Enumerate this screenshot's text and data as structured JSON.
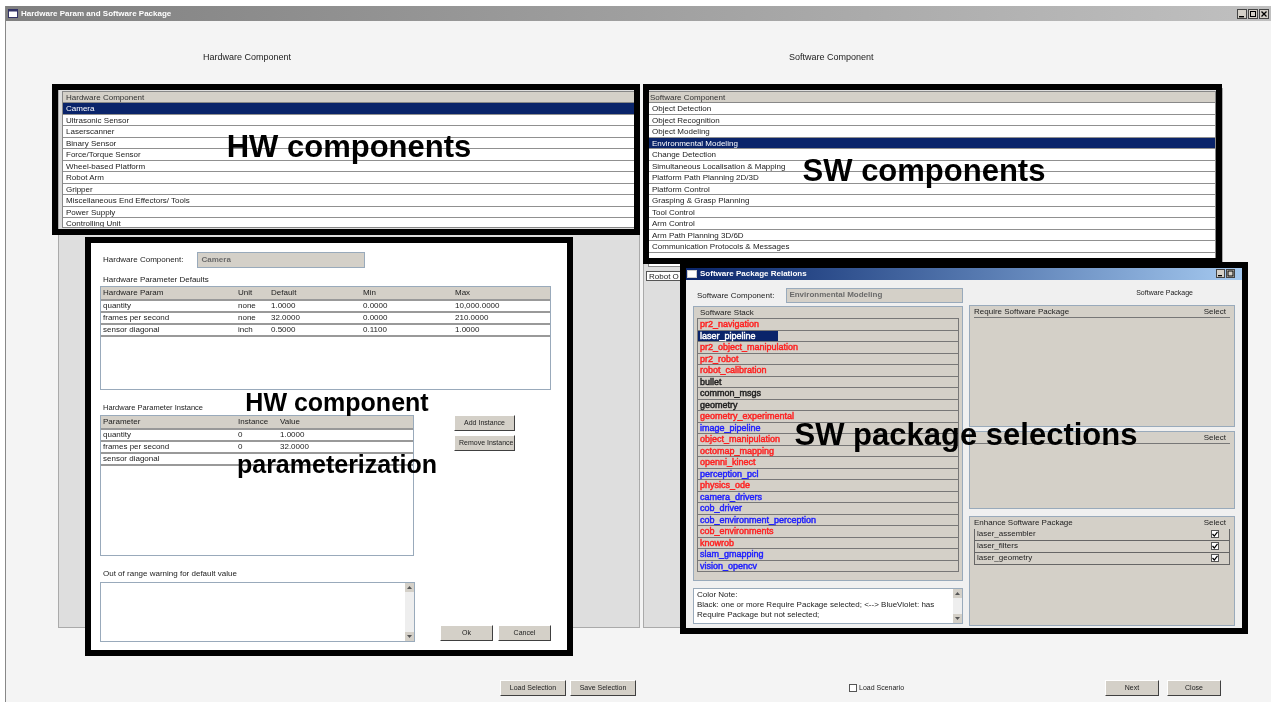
{
  "window": {
    "title": "Hardware Param and Software Package"
  },
  "hardware": {
    "heading": "Hardware Component",
    "list_header": "Hardware Component",
    "items": [
      {
        "label": "Camera",
        "selected": true
      },
      {
        "label": "Ultrasonic Sensor",
        "selected": false
      },
      {
        "label": "Laserscanner",
        "selected": false
      },
      {
        "label": "Binary Sensor",
        "selected": false
      },
      {
        "label": "Force/Torque Sensor",
        "selected": false
      },
      {
        "label": "Wheel-based Platform",
        "selected": false
      },
      {
        "label": "Robot Arm",
        "selected": false
      },
      {
        "label": "Gripper",
        "selected": false
      },
      {
        "label": "Miscellaneous End Effectors/ Tools",
        "selected": false
      },
      {
        "label": "Power Supply",
        "selected": false
      },
      {
        "label": "Controlling Unit",
        "selected": false
      }
    ]
  },
  "software": {
    "heading": "Software Component",
    "list_header": "Software Component",
    "items": [
      {
        "label": "Object Detection",
        "selected": false
      },
      {
        "label": "Object Recognition",
        "selected": false
      },
      {
        "label": "Object Modeling",
        "selected": false
      },
      {
        "label": "Environmental Modeling",
        "selected": true
      },
      {
        "label": "Change Detection",
        "selected": false
      },
      {
        "label": "Simultaneous Localisation & Mapping",
        "selected": false
      },
      {
        "label": "Platform Path Planning 2D/3D",
        "selected": false
      },
      {
        "label": "Platform Control",
        "selected": false
      },
      {
        "label": "Grasping & Grasp Planning",
        "selected": false
      },
      {
        "label": "Tool Control",
        "selected": false
      },
      {
        "label": "Arm Control",
        "selected": false
      },
      {
        "label": "Arm Path Planning 3D/6D",
        "selected": false
      },
      {
        "label": "Communication Protocols & Messages",
        "selected": false
      }
    ],
    "dropdown_value": "Robot O"
  },
  "hw_dialog": {
    "component_label": "Hardware Component:",
    "component_value": "Camera",
    "defaults_title": "Hardware Parameter Defaults",
    "defaults_columns": [
      "Hardware Param",
      "Unit",
      "Default",
      "Min",
      "Max"
    ],
    "defaults_rows": [
      [
        "quantity",
        "none",
        "1.0000",
        "0.0000",
        "10,000.0000"
      ],
      [
        "frames per second",
        "none",
        "32.0000",
        "0.0000",
        "210.0000"
      ],
      [
        "sensor diagonal",
        "inch",
        "0.5000",
        "0.1100",
        "1.0000"
      ]
    ],
    "instances_title": "Hardware Parameter Instance",
    "instance_columns": [
      "Parameter",
      "Instance",
      "Value"
    ],
    "instance_rows": [
      [
        "quantity",
        "0",
        "1.0000"
      ],
      [
        "frames per second",
        "0",
        "32.0000"
      ],
      [
        "sensor diagonal"
      ]
    ],
    "instance_buttons": [
      "Add Instance",
      "Remove Instance"
    ],
    "warning_label": "Out of range warning for default value",
    "footer_buttons": [
      "Ok",
      "Cancel"
    ]
  },
  "sw_dialog": {
    "title": "Software Package Relations",
    "component_label": "Software Component:",
    "component_value": "Environmental Modeling",
    "stack_header": "Software Stack",
    "packages": [
      {
        "name": "pr2_navigation",
        "selected": false,
        "color": "#ff2020"
      },
      {
        "name": "laser_pipeline",
        "selected": true
      },
      {
        "name": "pr2_object_manipulation",
        "selected": false,
        "color": "#ff2020"
      },
      {
        "name": "pr2_robot",
        "selected": false,
        "color": "#ff2020"
      },
      {
        "name": "robot_calibration",
        "selected": false,
        "color": "#ff2020"
      },
      {
        "name": "bullet",
        "selected": false,
        "color": "#202020"
      },
      {
        "name": "common_msgs",
        "selected": false,
        "color": "#202020"
      },
      {
        "name": "geometry",
        "selected": false,
        "color": "#202020"
      },
      {
        "name": "geometry_experimental",
        "selected": false,
        "color": "#ff2020"
      },
      {
        "name": "image_pipeline",
        "selected": false,
        "color": "#2020ff"
      },
      {
        "name": "object_manipulation",
        "selected": false,
        "color": "#ff2020"
      },
      {
        "name": "octomap_mapping",
        "selected": false,
        "color": "#ff2020"
      },
      {
        "name": "openni_kinect",
        "selected": false,
        "color": "#ff2020"
      },
      {
        "name": "perception_pcl",
        "selected": false,
        "color": "#2020ff"
      },
      {
        "name": "physics_ode",
        "selected": false,
        "color": "#ff2020"
      },
      {
        "name": "camera_drivers",
        "selected": false,
        "color": "#2020ff"
      },
      {
        "name": "cob_driver",
        "selected": false,
        "color": "#2020ff"
      },
      {
        "name": "cob_environment_perception",
        "selected": false,
        "color": "#2020ff"
      },
      {
        "name": "cob_environments",
        "selected": false,
        "color": "#ff2020"
      },
      {
        "name": "knowrob",
        "selected": false,
        "color": "#ff2020"
      },
      {
        "name": "slam_gmapping",
        "selected": false,
        "color": "#2020ff"
      },
      {
        "name": "vision_opencv",
        "selected": false,
        "color": "#2020ff"
      }
    ],
    "color_note": [
      "Color Note:",
      "Black: one or more Require Package selected; <--> BlueViolet: has Require Package but not selected;"
    ],
    "package_heading": "Software Package",
    "require": {
      "header": "Require Software Package",
      "select": "Select"
    },
    "depend": {
      "select": "Select"
    },
    "enhance": {
      "header": "Enhance Software Package",
      "select": "Select",
      "rows": [
        {
          "name": "laser_assembler",
          "checked": true
        },
        {
          "name": "laser_filters",
          "checked": true
        },
        {
          "name": "laser_geometry",
          "checked": true
        }
      ]
    }
  },
  "footer": {
    "buttons": [
      "Load Selection",
      "Save Selection"
    ],
    "load_scenario": {
      "label": "Load Scenario",
      "checked": false
    },
    "right_buttons": [
      "Next",
      "Close"
    ]
  },
  "annotations": [
    {
      "lines": [
        "HW components"
      ]
    },
    {
      "lines": [
        "SW components"
      ]
    },
    {
      "lines": [
        "HW component",
        "parameterization"
      ]
    },
    {
      "lines": [
        "SW package selections"
      ]
    }
  ]
}
